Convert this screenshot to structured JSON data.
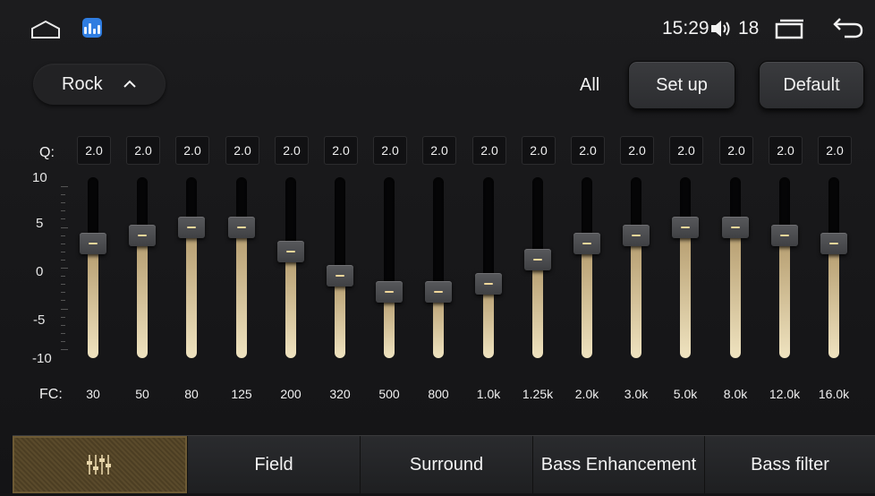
{
  "status_bar": {
    "time": "15:29",
    "volume": "18",
    "icons": [
      "home-icon",
      "app-icon",
      "volume-icon",
      "recent-apps-icon",
      "back-icon"
    ]
  },
  "preset": {
    "label": "Rock",
    "icon": "chevron-up-icon"
  },
  "channel_label": "All",
  "buttons": {
    "setup": "Set up",
    "default": "Default"
  },
  "eq": {
    "q_label": "Q:",
    "fc_label": "FC:",
    "scale": [
      "10",
      "5",
      "0",
      "-5",
      "-10"
    ],
    "range": [
      -10,
      10
    ],
    "bands": [
      {
        "fc": "30",
        "q": "2.0",
        "gain": 3
      },
      {
        "fc": "50",
        "q": "2.0",
        "gain": 4
      },
      {
        "fc": "80",
        "q": "2.0",
        "gain": 5
      },
      {
        "fc": "125",
        "q": "2.0",
        "gain": 5
      },
      {
        "fc": "200",
        "q": "2.0",
        "gain": 2
      },
      {
        "fc": "320",
        "q": "2.0",
        "gain": -1
      },
      {
        "fc": "500",
        "q": "2.0",
        "gain": -3
      },
      {
        "fc": "800",
        "q": "2.0",
        "gain": -3
      },
      {
        "fc": "1.0k",
        "q": "2.0",
        "gain": -2
      },
      {
        "fc": "1.25k",
        "q": "2.0",
        "gain": 1
      },
      {
        "fc": "2.0k",
        "q": "2.0",
        "gain": 3
      },
      {
        "fc": "3.0k",
        "q": "2.0",
        "gain": 4
      },
      {
        "fc": "5.0k",
        "q": "2.0",
        "gain": 5
      },
      {
        "fc": "8.0k",
        "q": "2.0",
        "gain": 5
      },
      {
        "fc": "12.0k",
        "q": "2.0",
        "gain": 4
      },
      {
        "fc": "16.0k",
        "q": "2.0",
        "gain": 3
      }
    ]
  },
  "tabs": [
    {
      "label": "",
      "icon": "equalizer-icon",
      "active": true
    },
    {
      "label": "Field",
      "active": false
    },
    {
      "label": "Surround",
      "active": false
    },
    {
      "label": "Bass Enhancement",
      "active": false
    },
    {
      "label": "Bass filter",
      "active": false
    }
  ],
  "colors": {
    "accent": "#f0d79a",
    "fill_top": "#b39a6c",
    "fill_bottom": "#efe3c0"
  }
}
